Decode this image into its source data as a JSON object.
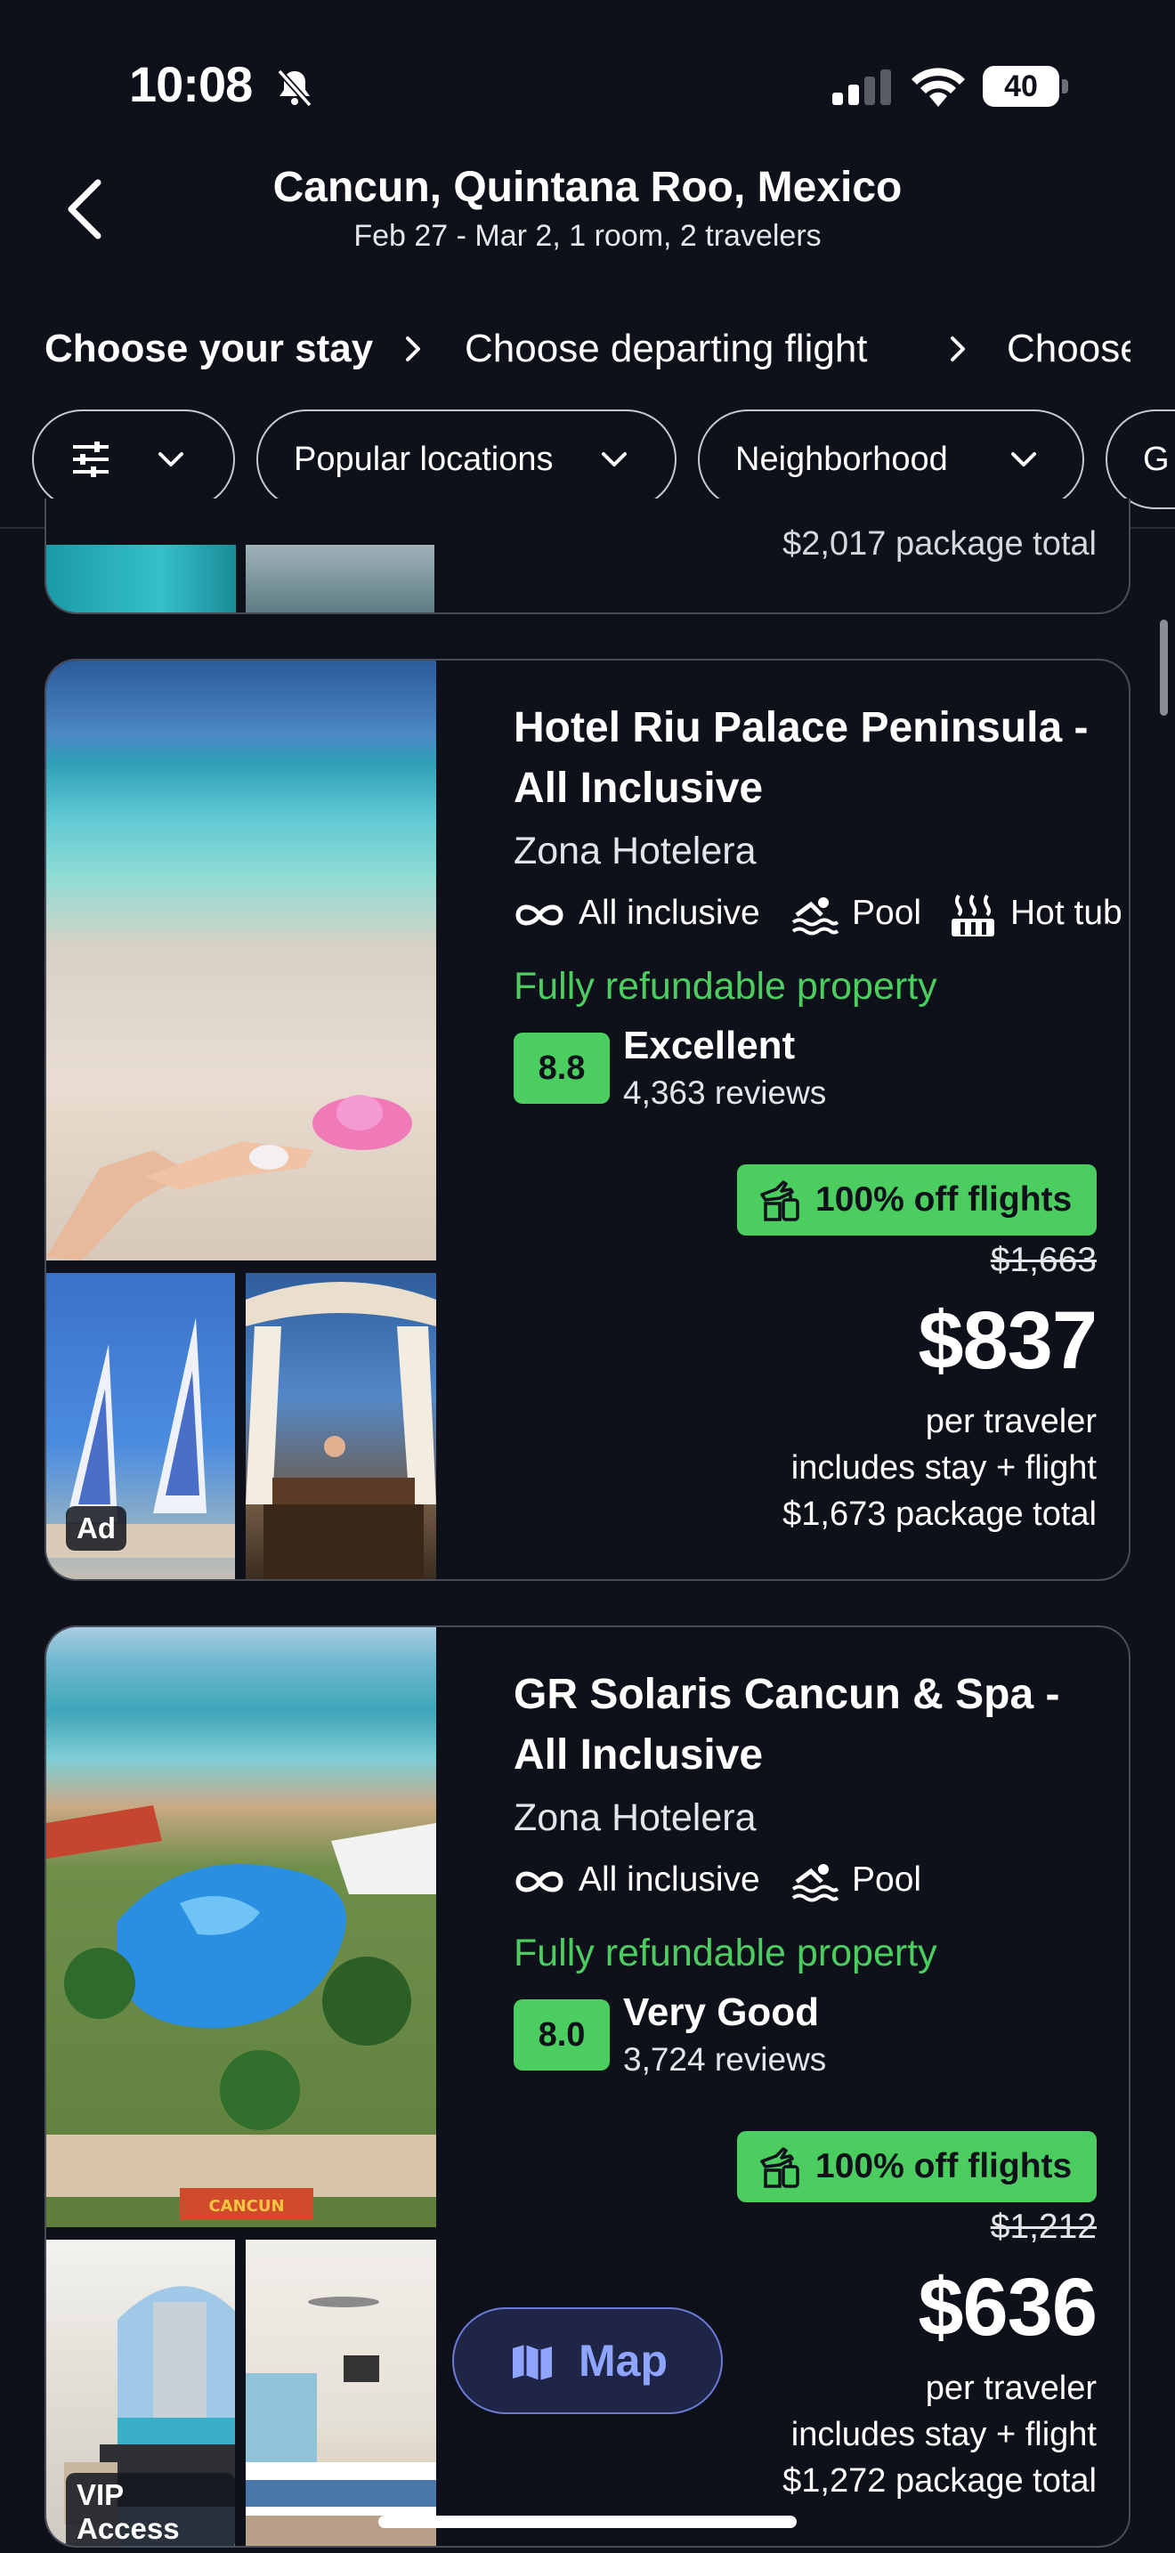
{
  "status_bar": {
    "time": "10:08",
    "battery": "40"
  },
  "header": {
    "title": "Cancun, Quintana Roo, Mexico",
    "subtitle": "Feb 27 - Mar 2, 1 room, 2 travelers"
  },
  "steps": [
    "Choose your stay",
    "Choose departing flight",
    "Choose"
  ],
  "filters": [
    "Popular locations",
    "Neighborhood",
    "G"
  ],
  "prev_card": {
    "package_total": "$2,017 package total"
  },
  "cards": [
    {
      "name_line1": "Hotel Riu Palace Peninsula -",
      "name_line2": "All Inclusive",
      "neighborhood": "Zona Hotelera",
      "amenities": [
        "All inclusive",
        "Pool",
        "Hot tub"
      ],
      "refundable": "Fully refundable property",
      "score": "8.8",
      "rating": "Excellent",
      "reviews": "4,363 reviews",
      "deal": "100% off flights",
      "old_price": "$1,663",
      "price": "$837",
      "per": "per traveler",
      "includes": "includes stay + flight",
      "package_total": "$1,673 package total",
      "badge": "Ad"
    },
    {
      "name_line1": "GR Solaris Cancun & Spa -",
      "name_line2": "All Inclusive",
      "neighborhood": "Zona Hotelera",
      "amenities": [
        "All inclusive",
        "Pool"
      ],
      "refundable": "Fully refundable property",
      "score": "8.0",
      "rating": "Very Good",
      "reviews": "3,724 reviews",
      "deal": "100% off flights",
      "old_price": "$1,212",
      "price": "$636",
      "per": "per traveler",
      "includes": "includes stay + flight",
      "package_total": "$1,272 package total",
      "badge": "VIP Access",
      "sign_text": "CANCUN"
    }
  ],
  "map_button": {
    "label": "Map"
  },
  "colors": {
    "background": "#0f111a",
    "accent_green": "#4bce5f",
    "map_blue": "#8ea4ff"
  }
}
